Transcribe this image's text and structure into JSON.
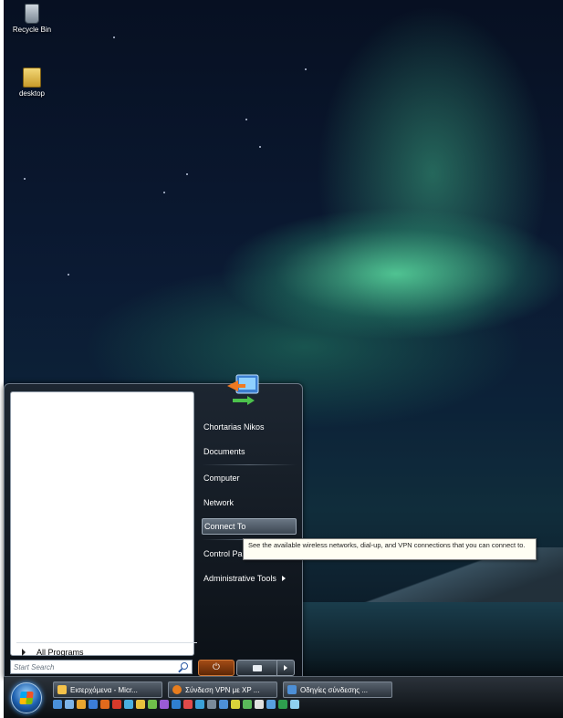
{
  "desktop": {
    "icons": [
      {
        "label": "Recycle Bin",
        "icon": "recycle-bin-icon"
      },
      {
        "label": "desktop",
        "icon": "folder-icon"
      }
    ]
  },
  "start_menu": {
    "all_programs": "All Programs",
    "search_placeholder": "Start Search",
    "right_items": [
      {
        "label": "Chortarias Nikos"
      },
      {
        "label": "Documents"
      },
      {
        "label": "Computer"
      },
      {
        "label": "Network"
      },
      {
        "label": "Connect To",
        "highlighted": true
      },
      {
        "label": "Control Pa"
      },
      {
        "label": "Administrative Tools",
        "has_submenu": true
      }
    ],
    "power_glyph": "⏻",
    "tooltip": "See the available wireless networks, dial-up, and VPN connections that you can connect to."
  },
  "taskbar": {
    "tasks": [
      {
        "label": "Εισερχόμενα - Micr...",
        "icon_color": "#f5c24a"
      },
      {
        "label": "Σύνδεση VPN με XP ...",
        "icon_color": "#e87d1e"
      },
      {
        "label": "Οδηγίες σύνδεσης ...",
        "icon_color": "#4d8fd6"
      }
    ],
    "quick_launch_colors": [
      "#4a90d9",
      "#7cb3e8",
      "#e8a530",
      "#3b7dd8",
      "#e06a1c",
      "#d93a2b",
      "#4ab0e0",
      "#e8c23d",
      "#6fbf4a",
      "#9a5bd6",
      "#2f7fd0",
      "#e04a4a",
      "#3aa0d8",
      "#7a8a9a",
      "#4d8fd6",
      "#d8d23a",
      "#5ab85a",
      "#e0e0e0",
      "#58a0e0",
      "#2e9e4e",
      "#8fd0f0"
    ]
  }
}
